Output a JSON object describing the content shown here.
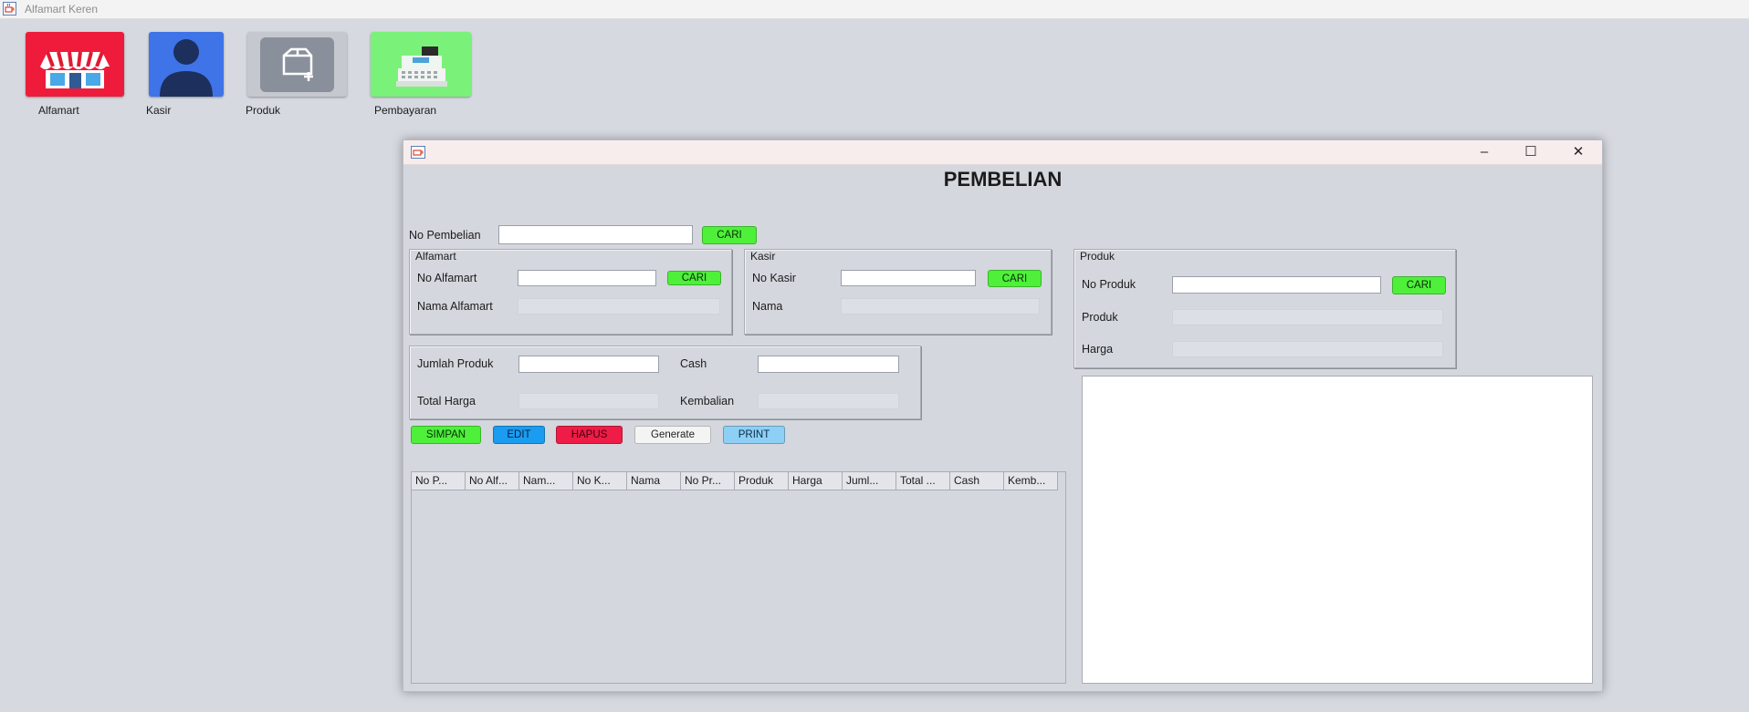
{
  "app": {
    "title": "Alfamart Keren"
  },
  "desktop": {
    "icons": [
      {
        "label": "Alfamart",
        "icon": "store-icon",
        "color": "#ee1c3a"
      },
      {
        "label": "Kasir",
        "icon": "user-icon",
        "color": "#3f73e8"
      },
      {
        "label": "Produk",
        "icon": "box-add-icon",
        "color": "#8a909b"
      },
      {
        "label": "Pembayaran",
        "icon": "cash-register-icon",
        "color": "#7af27a"
      }
    ]
  },
  "window": {
    "title": "",
    "heading": "PEMBELIAN",
    "controls": {
      "minimize": "–",
      "maximize": "☐",
      "close": "✕"
    }
  },
  "form": {
    "no_pembelian": {
      "label": "No Pembelian",
      "value": "",
      "button": "CARI"
    },
    "alfamart": {
      "title": "Alfamart",
      "no_label": "No Alfamart",
      "no_value": "",
      "button": "CARI",
      "nama_label": "Nama Alfamart",
      "nama_value": ""
    },
    "kasir": {
      "title": "Kasir",
      "no_label": "No Kasir",
      "no_value": "",
      "button": "CARI",
      "nama_label": "Nama",
      "nama_value": ""
    },
    "produk": {
      "title": "Produk",
      "no_label": "No Produk",
      "no_value": "",
      "button": "CARI",
      "produk_label": "Produk",
      "produk_value": "",
      "harga_label": "Harga",
      "harga_value": ""
    },
    "payment": {
      "jumlah_label": "Jumlah Produk",
      "jumlah_value": "",
      "cash_label": "Cash",
      "cash_value": "",
      "total_label": "Total Harga",
      "total_value": "",
      "kembalian_label": "Kembalian",
      "kembalian_value": ""
    }
  },
  "actions": {
    "simpan": "SIMPAN",
    "edit": "EDIT",
    "hapus": "HAPUS",
    "generate": "Generate",
    "print": "PRINT"
  },
  "table": {
    "columns": [
      "No P...",
      "No Alf...",
      "Nam...",
      "No K...",
      "Nama",
      "No Pr...",
      "Produk",
      "Harga",
      "Juml...",
      "Total ...",
      "Cash",
      "Kemb..."
    ],
    "rows": []
  },
  "receipt": {
    "text": ""
  }
}
